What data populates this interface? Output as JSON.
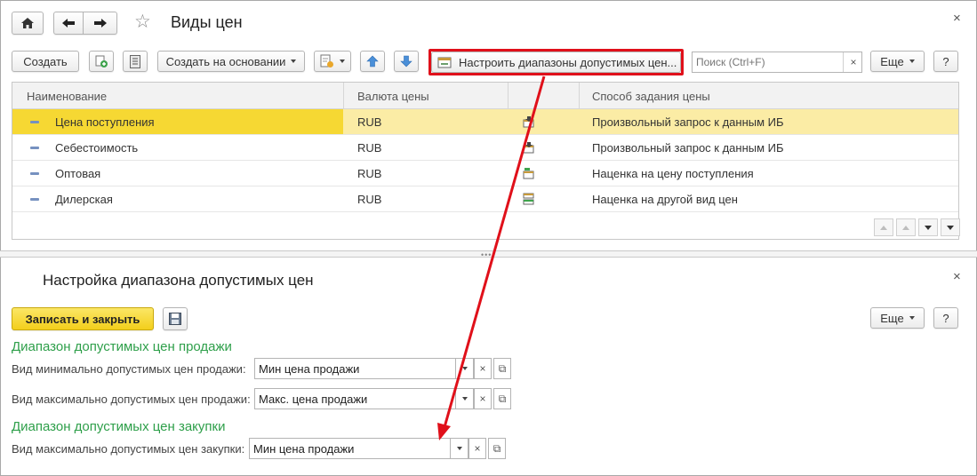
{
  "top_form": {
    "title": "Виды цен",
    "toolbar": {
      "create_label": "Создать",
      "create_based_label": "Создать на основании",
      "configure_label": "Настроить диапазоны допустимых цен...",
      "search_placeholder": "Поиск (Ctrl+F)",
      "search_clear": "×",
      "more_label": "Еще",
      "help_label": "?"
    },
    "columns": [
      "Наименование",
      "Валюта цены",
      "",
      "Способ задания цены"
    ],
    "rows": [
      {
        "name": "Цена поступления",
        "currency": "RUB",
        "method": "Произвольный запрос к данным ИБ"
      },
      {
        "name": "Себестоимость",
        "currency": "RUB",
        "method": "Произвольный запрос к данным ИБ"
      },
      {
        "name": "Оптовая",
        "currency": "RUB",
        "method": "Наценка на цену поступления"
      },
      {
        "name": "Дилерская",
        "currency": "RUB",
        "method": "Наценка на другой вид цен"
      }
    ],
    "close": "×"
  },
  "bottom_form": {
    "title": "Настройка диапазона допустимых цен",
    "save_close_label": "Записать и закрыть",
    "more_label": "Еще",
    "help_label": "?",
    "close": "×",
    "group_sales": "Диапазон допустимых цен продажи",
    "min_sale_label": "Вид минимально допустимых цен продажи:",
    "min_sale_value": "Мин цена продажи",
    "max_sale_label": "Вид максимально допустимых цен продажи:",
    "max_sale_value": "Макс. цена продажи",
    "group_purchase": "Диапазон допустимых цен закупки",
    "max_purchase_label": "Вид максимально допустимых цен закупки:",
    "max_purchase_value": "Мин цена продажи",
    "clear_glyph": "×",
    "open_glyph": "⧉"
  },
  "colors": {
    "accent_yellow": "#f6d833",
    "selected_row": "#fbeca5",
    "group_green": "#2e9f4a",
    "annotation_red": "#e0101a"
  }
}
